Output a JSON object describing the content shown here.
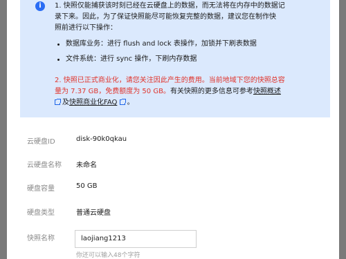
{
  "notice": {
    "item1_line1": "1. 快照仅能捕获该时刻已经在云硬盘上的数据，而无法将在内存中的数据记",
    "item1_line2": "录下来。因此，为了保证快照能尽可能恢复完整的数据，建议您在制作快",
    "item1_line3": "照前进行以下操作：",
    "bullet1": "数据库业务：进行 flush and lock 表操作，加锁并下刷表数据",
    "bullet2": "文件系统：进行 sync 操作，下刷内存数据",
    "item2_red_line1": "2. 快照已正式商业化，请您关注因此产生的费用。当前地域下您的快照总容",
    "item2_red_line2": "量为 7.37 GB，免费额度为 50 GB。",
    "item2_text": "有关快照的更多信息可参考",
    "link_overview": "快照概述",
    "and_text": "及",
    "link_faq": "快照商业化FAQ",
    "period": "。"
  },
  "fields": {
    "disk_id_label": "云硬盘ID",
    "disk_id_value": "disk-90k0qkau",
    "disk_name_label": "云硬盘名称",
    "disk_name_value": "未命名",
    "capacity_label": "硬盘容量",
    "capacity_value": "50 GB",
    "type_label": "硬盘类型",
    "type_value": "普通云硬盘",
    "snapshot_name_label": "快照名称",
    "snapshot_name_value": "laojiang1213",
    "snapshot_hint": "你还可以输入48个字符"
  }
}
